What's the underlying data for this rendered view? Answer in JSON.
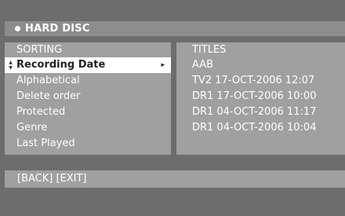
{
  "header": {
    "title": "HARD DISC"
  },
  "sorting": {
    "heading": "SORTING",
    "items": [
      {
        "label": "Recording Date"
      },
      {
        "label": "Alphabetical"
      },
      {
        "label": "Delete order"
      },
      {
        "label": "Protected"
      },
      {
        "label": "Genre"
      },
      {
        "label": "Last Played"
      }
    ],
    "selected_index": 0
  },
  "titles": {
    "heading": "TITLES",
    "items": [
      {
        "label": "AAB"
      },
      {
        "label": "TV2 17-OCT-2006 12:07"
      },
      {
        "label": "DR1 17-OCT-2006 10:00"
      },
      {
        "label": "DR1 04-OCT-2006 11:17"
      },
      {
        "label": "DR1 04-OCT-2006 10:04"
      }
    ]
  },
  "footer": {
    "hint": "[BACK] [EXIT]"
  },
  "icons": {
    "header_dot": "bullet-icon",
    "submenu_arrow": "chevron-right-icon",
    "scroll_indicator": "scroll-updown-icon"
  },
  "colors": {
    "background": "#6d6d6d",
    "header_bar": "#8d8d8d",
    "panel": "#a0a0a0",
    "selected_row": "#ffffff",
    "text": "#ffffff"
  }
}
